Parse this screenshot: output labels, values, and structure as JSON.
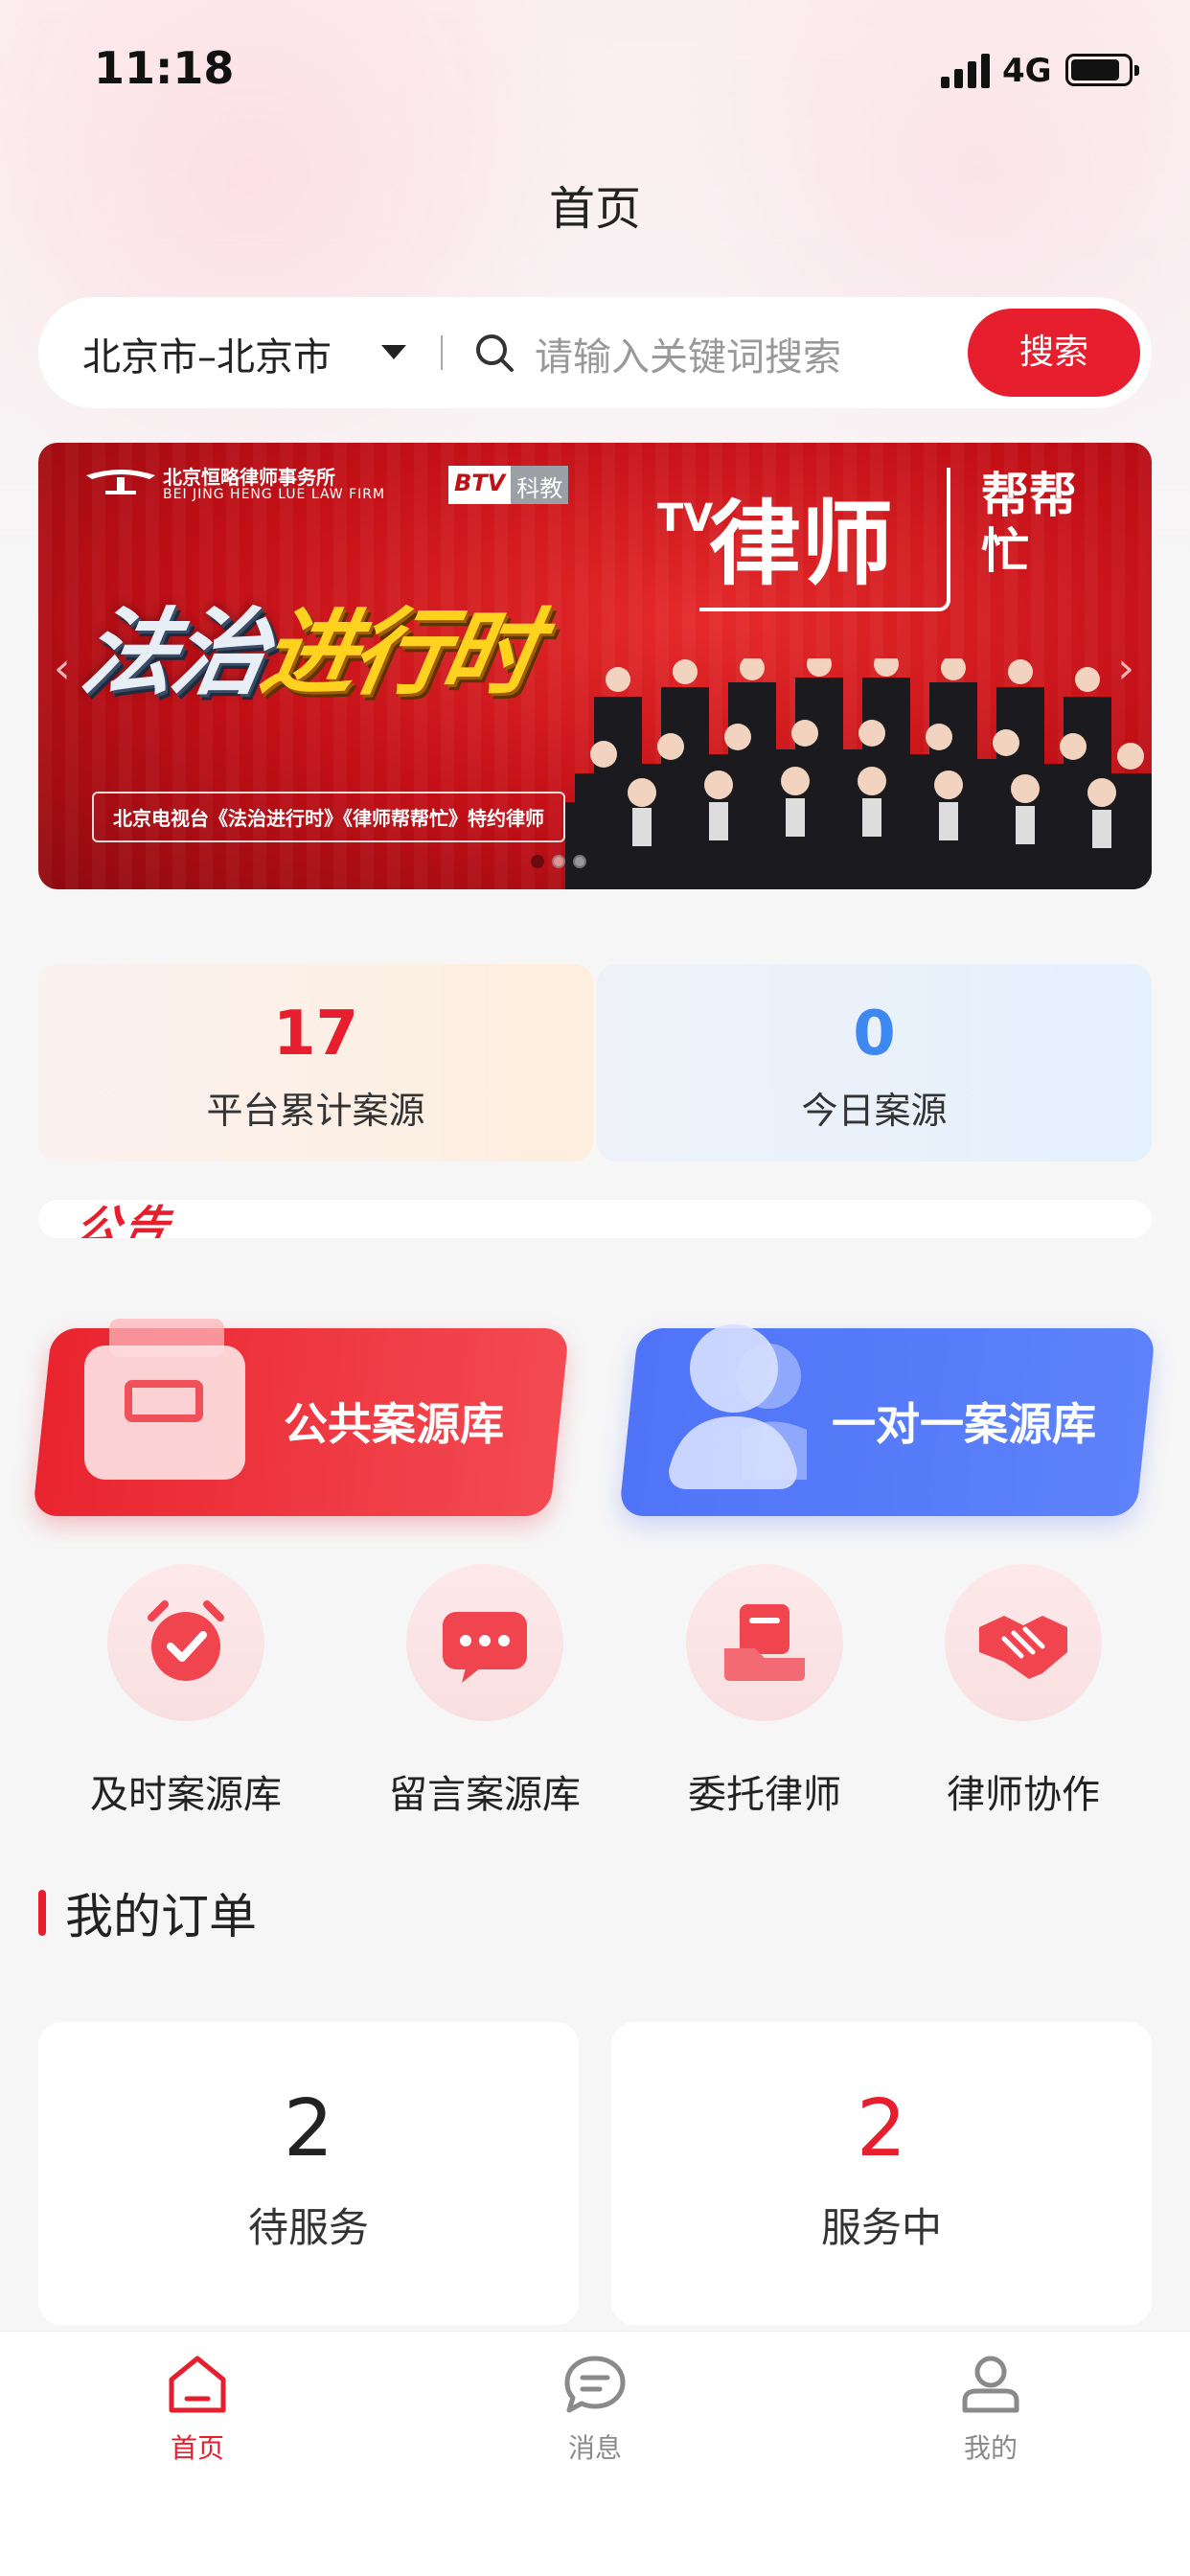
{
  "status": {
    "time": "11:18",
    "network": "4G"
  },
  "header": {
    "title": "首页"
  },
  "search": {
    "city": "北京市–北京市",
    "placeholder": "请输入关键词搜索",
    "button": "搜索"
  },
  "banner": {
    "firm_name": "北京恒略律师事务所",
    "firm_name_en": "BEI JING HENG LUE LAW FIRM",
    "btv_logo_a": "BTV",
    "btv_logo_b": "科教",
    "show_title_a": "法治",
    "show_title_b": "进行时",
    "tv_mark": "TV",
    "lawyer_title": "律师",
    "help_title": "帮帮忙",
    "caption": "北京电视台《法治进行时》《律师帮帮忙》特约律师",
    "slide_count": 3,
    "active_slide": 1,
    "colors": {
      "primary": "#c10f16"
    }
  },
  "stats": [
    {
      "value": "17",
      "label": "平台累计案源"
    },
    {
      "value": "0",
      "label": "今日案源"
    }
  ],
  "notice": {
    "title": "公告"
  },
  "cards": {
    "public": {
      "label": "公共案源库",
      "icon": "archive-box-icon"
    },
    "private": {
      "label": "一对一案源库",
      "icon": "user-group-icon"
    }
  },
  "quick": [
    {
      "label": "及时案源库",
      "icon": "alarm-clock-icon"
    },
    {
      "label": "留言案源库",
      "icon": "message-bubble-icon"
    },
    {
      "label": "委托律师",
      "icon": "delegate-lawyer-icon"
    },
    {
      "label": "律师协作",
      "icon": "handshake-icon"
    }
  ],
  "orders": {
    "title": "我的订单",
    "items": [
      {
        "value": "2",
        "label": "待服务"
      },
      {
        "value": "2",
        "label": "服务中"
      }
    ]
  },
  "tabs": [
    {
      "label": "首页",
      "icon": "home-icon",
      "active": true
    },
    {
      "label": "消息",
      "icon": "chat-icon",
      "active": false
    },
    {
      "label": "我的",
      "icon": "profile-icon",
      "active": false
    }
  ],
  "theme": {
    "accent": "#e61e2d",
    "blue": "#4f74f7",
    "stat_blue": "#3e88f2"
  }
}
